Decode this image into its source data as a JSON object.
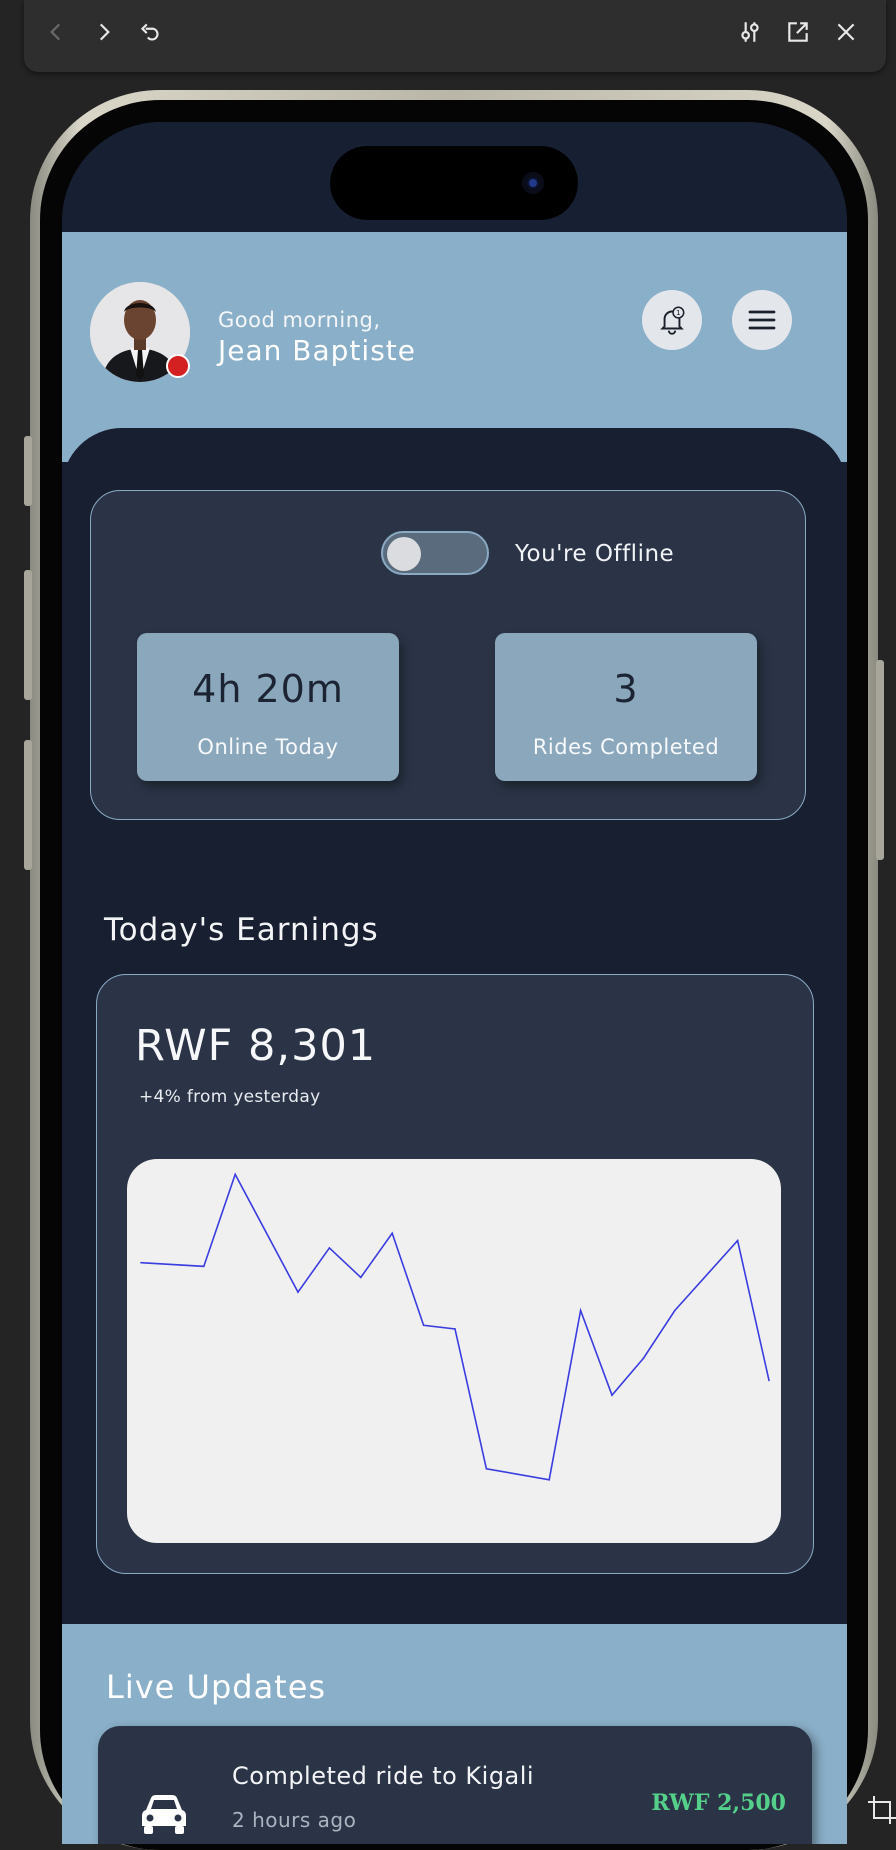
{
  "app": {
    "greeting": "Good morning,",
    "driver_name": "Jean Baptiste",
    "notification_count": "1"
  },
  "status": {
    "toggle_label": "You're Offline",
    "online_time_value": "4h 20m",
    "online_time_label": "Online Today",
    "rides_value": "3",
    "rides_label": "Rides Completed"
  },
  "earnings": {
    "section_title": "Today's Earnings",
    "amount": "RWF 8,301",
    "delta": "+4% from yesterday"
  },
  "chart_data": {
    "type": "line",
    "title": "",
    "xlabel": "",
    "ylabel": "",
    "ylim": [
      0,
      100
    ],
    "grid": false,
    "series": [
      {
        "color": "#3a3de0",
        "values": [
          74,
          73,
          98,
          66,
          78,
          70,
          82,
          57,
          56,
          18,
          15,
          61,
          38,
          48,
          61,
          80,
          42
        ]
      }
    ],
    "x": [
      0,
      2,
      3,
      5,
      6,
      7,
      8,
      9,
      10,
      11,
      13,
      14,
      15,
      16,
      17,
      19,
      20
    ]
  },
  "live_updates": {
    "title": "Live Updates",
    "items": [
      {
        "title": "Completed ride to Kigali",
        "time": "2 hours ago",
        "amount": "RWF 2,500"
      }
    ]
  },
  "colors": {
    "accent": "#8aafc8",
    "dark": "#171f31",
    "card": "#2a3446",
    "offline_dot": "#d32020",
    "amount_green": "#55d08a"
  },
  "icons": {
    "back": "chevron-left-icon",
    "forward": "chevron-right-icon",
    "reload": "reload-icon",
    "settings": "sliders-icon",
    "external": "external-link-icon",
    "close": "close-icon",
    "bell": "bell-icon",
    "menu": "hamburger-menu-icon",
    "car": "car-icon"
  }
}
